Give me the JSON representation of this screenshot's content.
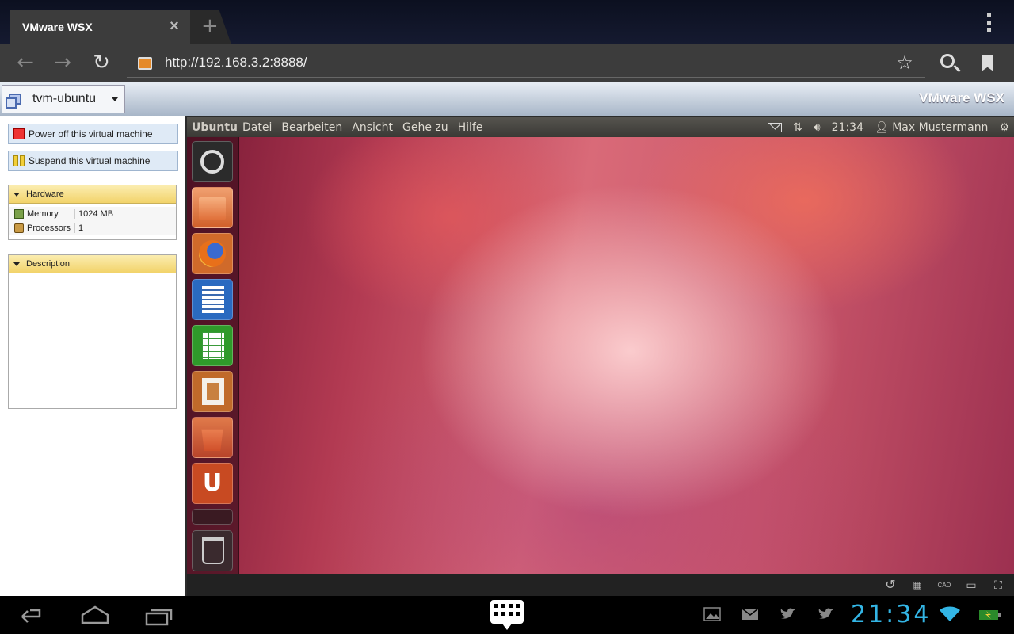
{
  "browser": {
    "tab_title": "VMware WSX",
    "new_tab_symbol": "+",
    "url": "http://192.168.3.2:8888/"
  },
  "wsx": {
    "vm_selected": "tvm-ubuntu",
    "brand": "VMware WSX",
    "actions": [
      {
        "label": "Power off this virtual machine",
        "icon": "power-off-icon",
        "color": "#e33333"
      },
      {
        "label": "Suspend this virtual machine",
        "icon": "suspend-icon",
        "color": "#f2cf39"
      }
    ],
    "hardware": {
      "title": "Hardware",
      "rows": [
        {
          "label": "Memory",
          "value": "1024 MB",
          "icon": "memory-icon"
        },
        {
          "label": "Processors",
          "value": "1",
          "icon": "processor-icon"
        }
      ]
    },
    "description": {
      "title": "Description"
    }
  },
  "guest": {
    "brand": "Ubuntu-",
    "menus": [
      "Datei",
      "Bearbeiten",
      "Ansicht",
      "Gehe zu",
      "Hilfe"
    ],
    "clock": "21:34",
    "user": "Max Mustermann",
    "launcher": [
      "dash-icon",
      "files-icon",
      "firefox-icon",
      "writer-icon",
      "calc-icon",
      "impress-icon",
      "software-center-icon",
      "ubuntu-one-icon",
      "workspaces-icon",
      "trash-icon"
    ],
    "console_controls": {
      "cad_label": "CAD"
    }
  },
  "android": {
    "clock": "21:34"
  },
  "colors": {
    "accent": "#33b5e5",
    "wsx_header": "#a8b6c8",
    "panel_header": "#f2d36a"
  }
}
